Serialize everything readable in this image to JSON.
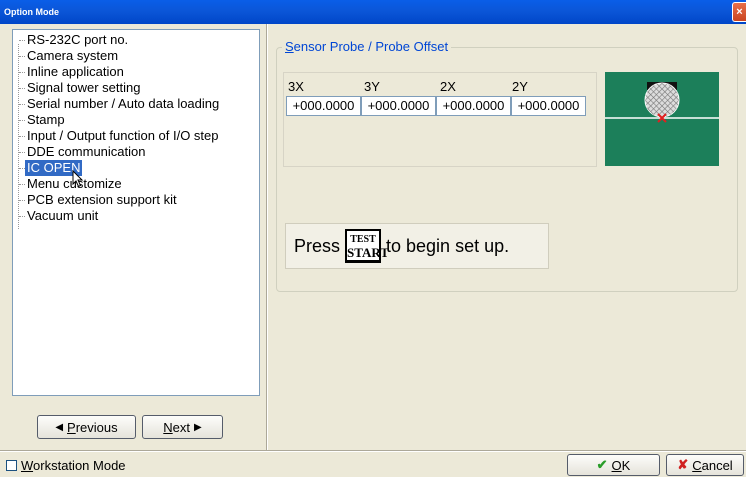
{
  "window": {
    "title": "Option Mode",
    "close_glyph": "×"
  },
  "tree": {
    "items": [
      {
        "label": "RS-232C port no."
      },
      {
        "label": "Camera system"
      },
      {
        "label": "Inline application"
      },
      {
        "label": "Signal tower setting"
      },
      {
        "label": "Serial number / Auto data loading"
      },
      {
        "label": "Stamp"
      },
      {
        "label": "Input / Output function of I/O step"
      },
      {
        "label": "DDE communication"
      },
      {
        "label": "IC OPEN",
        "selected": true
      },
      {
        "label": "Menu customize"
      },
      {
        "label": "PCB extension support kit"
      },
      {
        "label": "Vacuum unit"
      }
    ]
  },
  "nav": {
    "previous_arrow": "◀",
    "previous_mnemonic": "P",
    "previous_rest": "revious",
    "next_mnemonic": "N",
    "next_rest": "ext",
    "next_arrow": "▶"
  },
  "group": {
    "title_mnemonic": "S",
    "title_rest": "ensor Probe / Probe Offset",
    "columns": [
      {
        "label": "3X",
        "value": "+000.0000"
      },
      {
        "label": "3Y",
        "value": "+000.0000"
      },
      {
        "label": "2X",
        "value": "+000.0000"
      },
      {
        "label": "2Y",
        "value": "+000.0000"
      }
    ],
    "press_text": "Press",
    "key_top": "TEST",
    "key_bottom": "START",
    "begin_text": "to begin set up."
  },
  "footer": {
    "workstation_mnemonic": "W",
    "workstation_rest": "orkstation Mode",
    "workstation_checked": false,
    "ok_icon": "✔",
    "ok_mnemonic": "O",
    "ok_rest": "K",
    "cancel_icon": "✘",
    "cancel_mnemonic": "C",
    "cancel_rest": "ancel"
  },
  "colors": {
    "titlebar": "#0a5ee8",
    "selection": "#316ac5",
    "group_title": "#0046d5",
    "diagram_bg": "#1c7f5a",
    "ok_check": "#2a9d2a",
    "cancel_x": "#d02020"
  }
}
